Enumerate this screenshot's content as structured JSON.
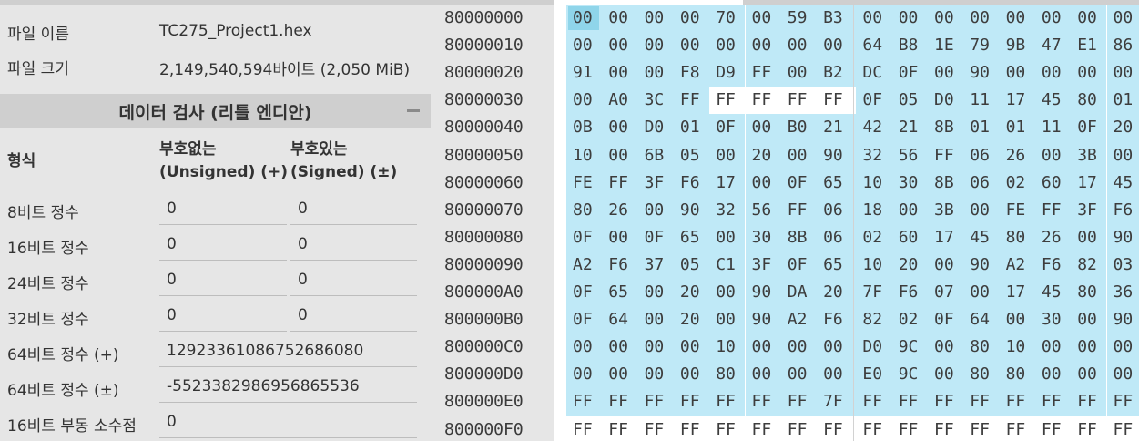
{
  "file_info": {
    "name_label": "파일 이름",
    "name_value": "TC275_Project1.hex",
    "size_label": "파일 크기",
    "size_value": "2,149,540,594바이트 (2,050 MiB)"
  },
  "inspector": {
    "title": "데이터 검사 (리틀 엔디안)",
    "col_format": "형식",
    "col_unsigned": "부호없는\n(Unsigned) (+)",
    "col_signed": "부호있는\n(Signed) (±)",
    "rows": [
      {
        "label": "8비트 정수",
        "unsigned": "0",
        "signed": "0"
      },
      {
        "label": "16비트 정수",
        "unsigned": "0",
        "signed": "0"
      },
      {
        "label": "24비트 정수",
        "unsigned": "0",
        "signed": "0"
      },
      {
        "label": "32비트 정수",
        "unsigned": "0",
        "signed": "0"
      },
      {
        "label": "64비트 정수 (+)",
        "value": "12923361086752686080"
      },
      {
        "label": "64비트 정수 (±)",
        "value": "-5523382986956865536"
      },
      {
        "label": "16비트 부동 소수점",
        "value": "0"
      }
    ]
  },
  "hex_view": {
    "colors": {
      "selection": "#bfe9f7",
      "cursor": "#8fd5ea",
      "divider": "#d2d2d2"
    },
    "selection": {
      "start": 0,
      "end": 239,
      "unselected": [
        52,
        53,
        54,
        55
      ]
    },
    "rows": [
      {
        "address": "80000000",
        "bytes": [
          "00",
          "00",
          "00",
          "00",
          "70",
          "00",
          "59",
          "B3",
          "00",
          "00",
          "00",
          "00",
          "00",
          "00",
          "00",
          "00"
        ]
      },
      {
        "address": "80000010",
        "bytes": [
          "00",
          "00",
          "00",
          "00",
          "00",
          "00",
          "00",
          "00",
          "64",
          "B8",
          "1E",
          "79",
          "9B",
          "47",
          "E1",
          "86"
        ]
      },
      {
        "address": "80000020",
        "bytes": [
          "91",
          "00",
          "00",
          "F8",
          "D9",
          "FF",
          "00",
          "B2",
          "DC",
          "0F",
          "00",
          "90",
          "00",
          "00",
          "00",
          "00"
        ]
      },
      {
        "address": "80000030",
        "bytes": [
          "00",
          "A0",
          "3C",
          "FF",
          "FF",
          "FF",
          "FF",
          "FF",
          "0F",
          "05",
          "D0",
          "11",
          "17",
          "45",
          "80",
          "01"
        ]
      },
      {
        "address": "80000040",
        "bytes": [
          "0B",
          "00",
          "D0",
          "01",
          "0F",
          "00",
          "B0",
          "21",
          "42",
          "21",
          "8B",
          "01",
          "01",
          "11",
          "0F",
          "20"
        ]
      },
      {
        "address": "80000050",
        "bytes": [
          "10",
          "00",
          "6B",
          "05",
          "00",
          "20",
          "00",
          "90",
          "32",
          "56",
          "FF",
          "06",
          "26",
          "00",
          "3B",
          "00"
        ]
      },
      {
        "address": "80000060",
        "bytes": [
          "FE",
          "FF",
          "3F",
          "F6",
          "17",
          "00",
          "0F",
          "65",
          "10",
          "30",
          "8B",
          "06",
          "02",
          "60",
          "17",
          "45"
        ]
      },
      {
        "address": "80000070",
        "bytes": [
          "80",
          "26",
          "00",
          "90",
          "32",
          "56",
          "FF",
          "06",
          "18",
          "00",
          "3B",
          "00",
          "FE",
          "FF",
          "3F",
          "F6"
        ]
      },
      {
        "address": "80000080",
        "bytes": [
          "0F",
          "00",
          "0F",
          "65",
          "00",
          "30",
          "8B",
          "06",
          "02",
          "60",
          "17",
          "45",
          "80",
          "26",
          "00",
          "90"
        ]
      },
      {
        "address": "80000090",
        "bytes": [
          "A2",
          "F6",
          "37",
          "05",
          "C1",
          "3F",
          "0F",
          "65",
          "10",
          "20",
          "00",
          "90",
          "A2",
          "F6",
          "82",
          "03"
        ]
      },
      {
        "address": "800000A0",
        "bytes": [
          "0F",
          "65",
          "00",
          "20",
          "00",
          "90",
          "DA",
          "20",
          "7F",
          "F6",
          "07",
          "00",
          "17",
          "45",
          "80",
          "36"
        ]
      },
      {
        "address": "800000B0",
        "bytes": [
          "0F",
          "64",
          "00",
          "20",
          "00",
          "90",
          "A2",
          "F6",
          "82",
          "02",
          "0F",
          "64",
          "00",
          "30",
          "00",
          "90"
        ]
      },
      {
        "address": "800000C0",
        "bytes": [
          "00",
          "00",
          "00",
          "00",
          "10",
          "00",
          "00",
          "00",
          "D0",
          "9C",
          "00",
          "80",
          "10",
          "00",
          "00",
          "00"
        ]
      },
      {
        "address": "800000D0",
        "bytes": [
          "00",
          "00",
          "00",
          "00",
          "80",
          "00",
          "00",
          "00",
          "E0",
          "9C",
          "00",
          "80",
          "80",
          "00",
          "00",
          "00"
        ]
      },
      {
        "address": "800000E0",
        "bytes": [
          "FF",
          "FF",
          "FF",
          "FF",
          "FF",
          "FF",
          "FF",
          "7F",
          "FF",
          "FF",
          "FF",
          "FF",
          "FF",
          "FF",
          "FF",
          "FF"
        ]
      },
      {
        "address": "800000F0",
        "bytes": [
          "FF",
          "FF",
          "FF",
          "FF",
          "FF",
          "FF",
          "FF",
          "FF",
          "FF",
          "FF",
          "FF",
          "FF",
          "FF",
          "FF",
          "FF",
          "FF"
        ]
      }
    ]
  }
}
